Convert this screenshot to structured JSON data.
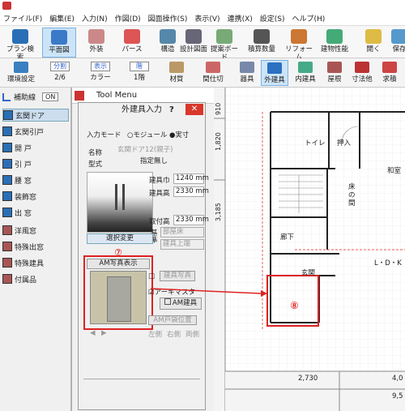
{
  "menu": [
    "ファイル(F)",
    "編集(E)",
    "入力(N)",
    "作図(D)",
    "図面操作(S)",
    "表示(V)",
    "連携(X)",
    "設定(S)",
    "ヘルプ(H)"
  ],
  "toolbar1": [
    {
      "label": "プラン検索",
      "icon": "search-icon"
    },
    {
      "label": "平面図",
      "icon": "floor-plan-icon",
      "active": true
    },
    {
      "label": "外装",
      "icon": "exterior-icon"
    },
    {
      "label": "パース",
      "icon": "house-perspective-icon"
    },
    {
      "label": "構造",
      "icon": "structure-icon"
    },
    {
      "label": "設計図面",
      "icon": "pro-drawing-icon"
    },
    {
      "label": "提案ボード",
      "icon": "board-icon"
    },
    {
      "label": "積算数量",
      "icon": "quantity-icon"
    },
    {
      "label": "リフォーム",
      "icon": "reform-icon"
    },
    {
      "label": "建物性能",
      "icon": "performance-icon"
    },
    {
      "label": "開く",
      "icon": "open-icon"
    },
    {
      "label": "保存",
      "icon": "save-icon"
    }
  ],
  "toolbar2": [
    {
      "label": "環境設定",
      "icon": "gear-icon"
    },
    {
      "label": "2/6",
      "top": "分割",
      "icon": "split-icon"
    },
    {
      "label": "カラー",
      "top": "表示",
      "icon": "display-icon"
    },
    {
      "label": "1階",
      "top": "階",
      "icon": "floor-icon"
    },
    {
      "label": "材質",
      "icon": "material-icon"
    },
    {
      "label": "間仕切",
      "icon": "partition-icon"
    },
    {
      "label": "器具",
      "icon": "fixture-icon"
    },
    {
      "label": "外建具",
      "icon": "exterior-fitting-icon",
      "active": true
    },
    {
      "label": "内建具",
      "icon": "interior-fitting-icon"
    },
    {
      "label": "屋根",
      "icon": "roof-icon"
    },
    {
      "label": "寸法他",
      "icon": "dimension-icon"
    },
    {
      "label": "求積",
      "icon": "area-calc-icon"
    }
  ],
  "sidebar": {
    "toggle_label": "補助線",
    "toggle_state": "ON",
    "items": [
      {
        "label": "玄関ドア",
        "selected": true
      },
      {
        "label": "玄関引戸"
      },
      {
        "label": "開 戸"
      },
      {
        "label": "引 戸"
      },
      {
        "label": "腰 窓"
      },
      {
        "label": "装飾窓"
      },
      {
        "label": "出 窓"
      },
      {
        "label": "洋風窓"
      },
      {
        "label": "特殊出窓"
      },
      {
        "label": "特殊建具"
      },
      {
        "label": "付属品"
      }
    ]
  },
  "tool_menu": {
    "title": "Tool Menu"
  },
  "dialog": {
    "title": "外建具入力",
    "mode_label": "入力モード",
    "mode_options": [
      "モジュール",
      "実寸"
    ],
    "mode_selected": "実寸",
    "name_label": "名称",
    "name_value": "玄関ドア12(親子)",
    "type_label": "型式",
    "type_value": "指定無し",
    "width_label": "建具巾",
    "width_value": "1240 mm",
    "height_label": "建具高",
    "height_value": "2330 mm",
    "mount_label": "取付高",
    "mount_value": "2330 mm",
    "base_label": "基準",
    "base_opt1": "部屋床",
    "base_opt2": "建具上端",
    "select_change": "選択変更",
    "am_photo_display": "AM写真表示",
    "fitting_photo": "建具写真",
    "archimaster_label": "アーキマスタ",
    "am_fitting_button": "AM建具",
    "am_pocket": "AM戸袋位置",
    "sides": [
      "左側",
      "右側",
      "両側"
    ],
    "annotation_7": "⑦",
    "annotation_8": "⑧"
  },
  "drawing": {
    "rooms": [
      "トイレ",
      "押入",
      "和室",
      "床の間",
      "廊下",
      "玄関",
      "L・D・K"
    ],
    "dims_v": [
      "910",
      "1,820",
      "3,185"
    ],
    "dims_h": [
      "2,730",
      "4,0",
      "9,5"
    ]
  }
}
